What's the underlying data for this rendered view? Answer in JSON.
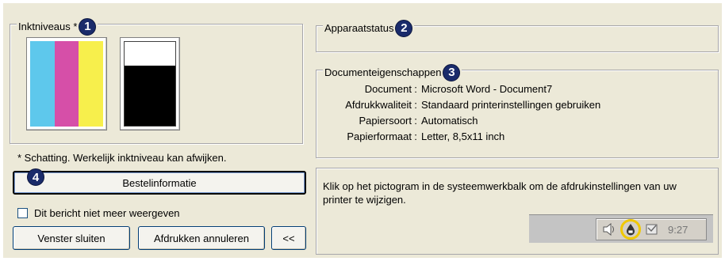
{
  "ink": {
    "legend": "Inktniveaus *",
    "badge": "1",
    "colors": [
      "#5ec8ec",
      "#d64fa8",
      "#f7ef4c"
    ],
    "note": "* Schatting.  Werkelijk inktniveau kan afwijken."
  },
  "status": {
    "legend": "Apparaatstatus",
    "badge": "2"
  },
  "document_properties": {
    "legend": "Documenteigenschappen",
    "badge": "3",
    "rows": [
      {
        "label": "Document",
        "value": "Microsoft Word - Document7"
      },
      {
        "label": "Afdrukkwaliteit",
        "value": "Standaard printerinstellingen gebruiken"
      },
      {
        "label": "Papiersoort",
        "value": "Automatisch"
      },
      {
        "label": "Papierformaat",
        "value": "Letter, 8,5x11 inch"
      }
    ]
  },
  "order": {
    "badge": "4",
    "button_label": "Bestelinformatie"
  },
  "checkbox_label": "Dit bericht niet meer weergeven",
  "buttons": {
    "close": "Venster sluiten",
    "cancel": "Afdrukken annuleren",
    "collapse": "<<"
  },
  "info": {
    "text": "Klik op het pictogram in de systeemwerkbalk om de afdrukinstellingen van uw printer te wijzigen.",
    "clock": "9:27"
  },
  "icons": {
    "speaker": "speaker-icon",
    "printer": "printer-tray-icon",
    "other": "tray-app-icon"
  }
}
